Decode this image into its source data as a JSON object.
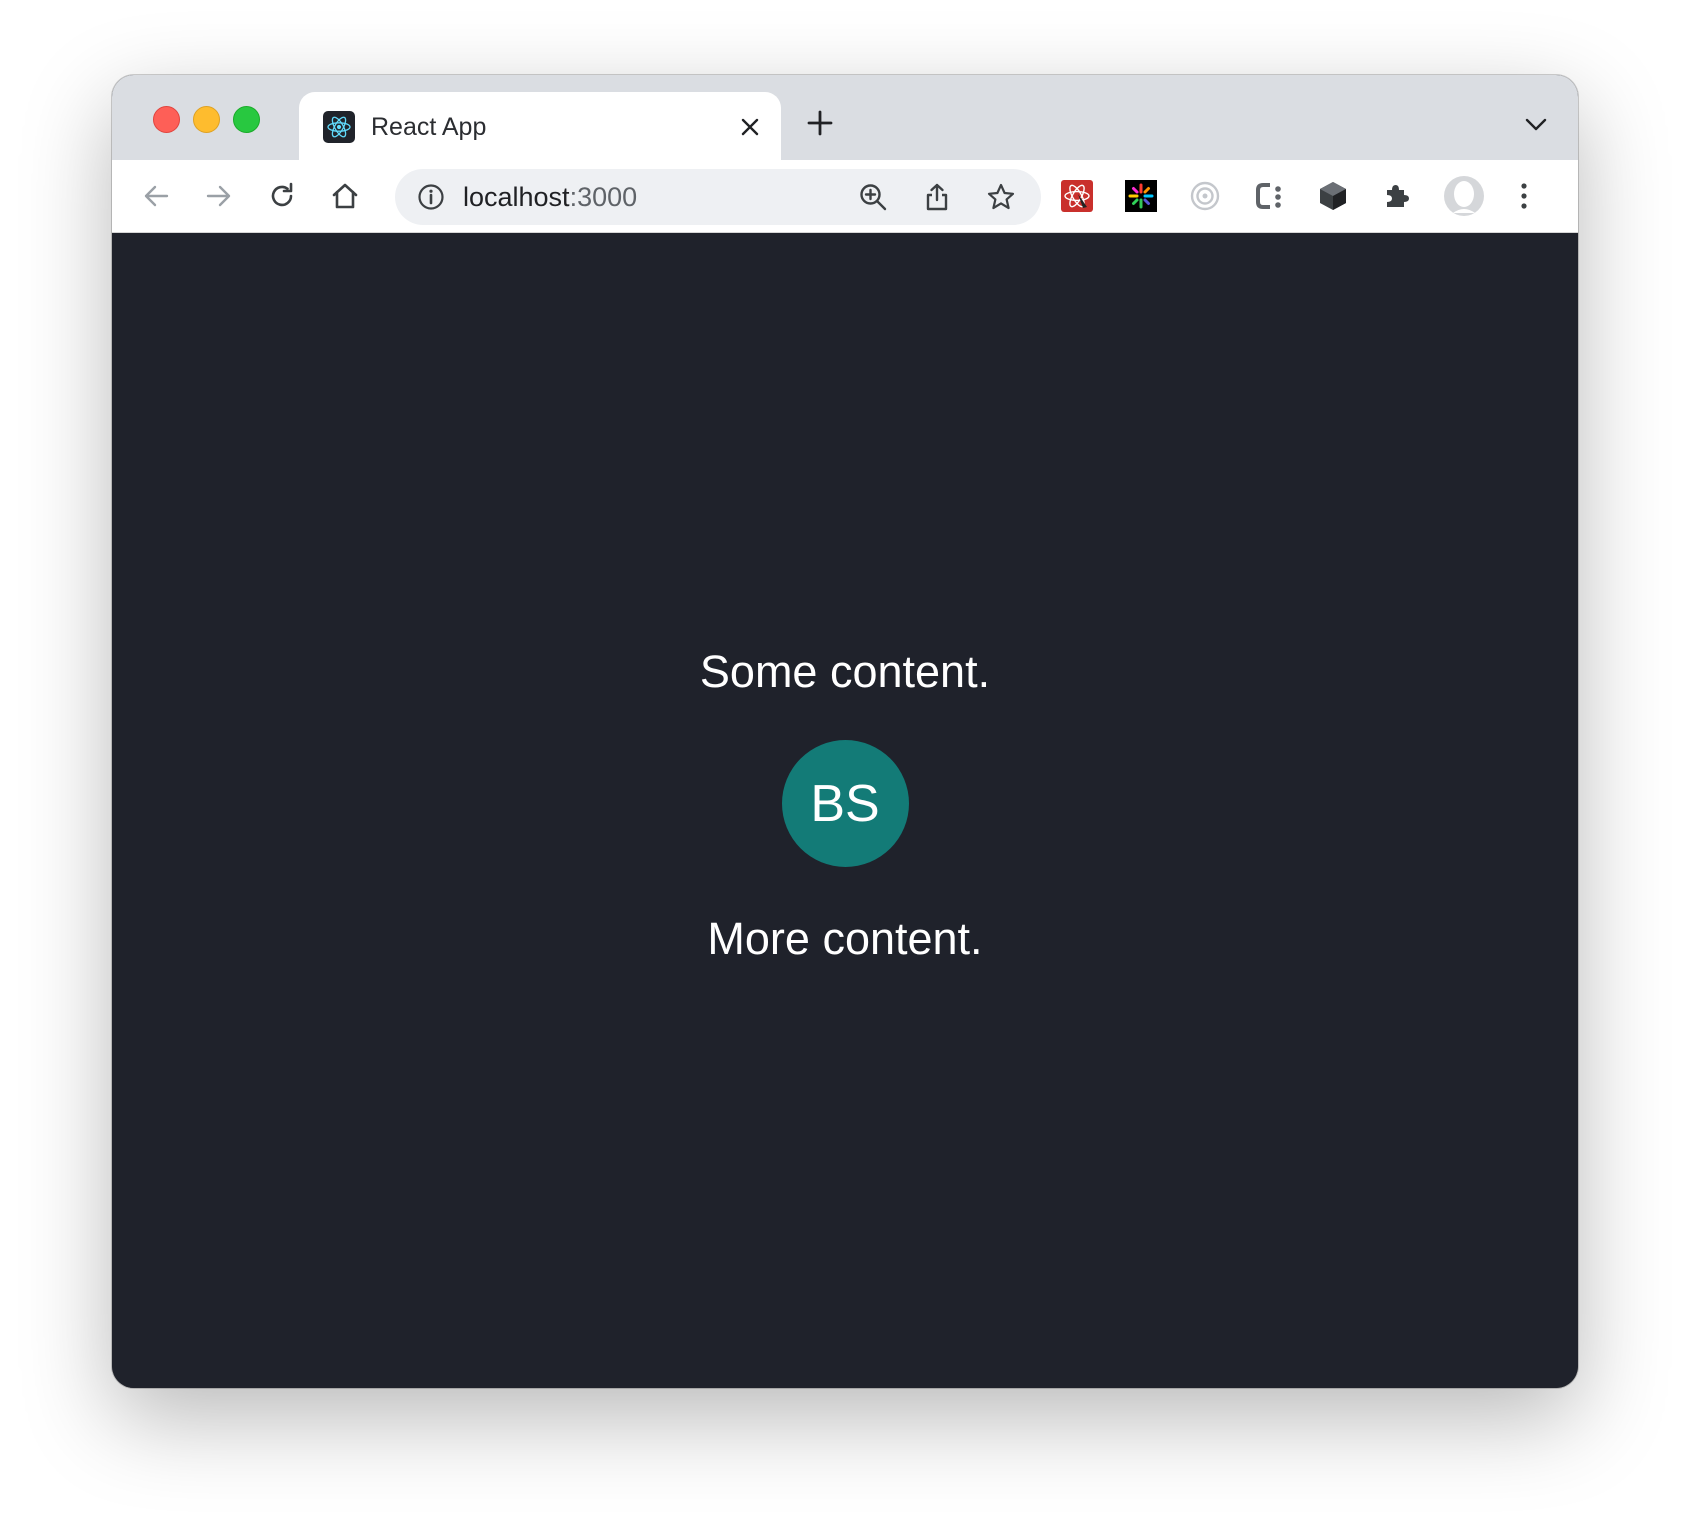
{
  "browser": {
    "tab": {
      "title": "React App",
      "favicon": "react-logo-icon"
    },
    "address_bar": {
      "host": "localhost",
      "port": ":3000"
    },
    "extensions": [
      "react-devtools-icon",
      "colorful-asterisk-extension-icon",
      "target-extension-icon",
      "ci-extension-icon",
      "cube-extension-icon",
      "puzzle-icon"
    ]
  },
  "page": {
    "background": "#1f222b",
    "top_text": "Some content.",
    "avatar_initials": "BS",
    "avatar_color": "#137b77",
    "bottom_text": "More content."
  }
}
